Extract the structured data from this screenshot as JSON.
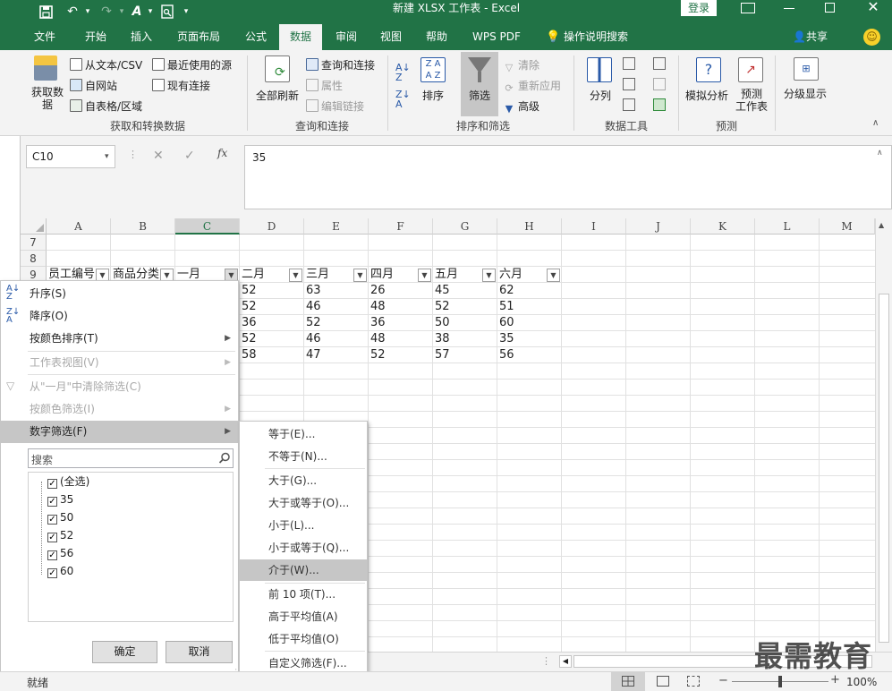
{
  "window": {
    "title": "新建 XLSX 工作表 - Excel",
    "login": "登录"
  },
  "tabs": [
    "文件",
    "开始",
    "插入",
    "页面布局",
    "公式",
    "数据",
    "审阅",
    "视图",
    "帮助",
    "WPS PDF"
  ],
  "active_tab": "数据",
  "tell_me": "操作说明搜索",
  "share": "共享",
  "ribbon": {
    "get_data": "获取数\n据",
    "from_text_csv": "从文本/CSV",
    "from_web": "自网站",
    "from_table": "自表格/区域",
    "recent_sources": "最近使用的源",
    "existing_connections": "现有连接",
    "group1_label": "获取和转换数据",
    "refresh_all": "全部刷新",
    "queries_connections": "查询和连接",
    "properties": "属性",
    "edit_links": "编辑链接",
    "group2_label": "查询和连接",
    "sort": "排序",
    "filter": "筛选",
    "clear": "清除",
    "reapply": "重新应用",
    "advanced": "高级",
    "group3_label": "排序和筛选",
    "text_to_columns": "分列",
    "group4_label": "数据工具",
    "what_if": "模拟分析",
    "forecast_sheet": "预测\n工作表",
    "group5_label": "预测",
    "outline": "分级显示"
  },
  "formula_bar": {
    "name_box": "C10",
    "value": "35",
    "fx": "fx"
  },
  "sheet": {
    "columns": [
      "A",
      "B",
      "C",
      "D",
      "E",
      "F",
      "G",
      "H",
      "I",
      "J",
      "K",
      "L",
      "M"
    ],
    "row_numbers": [
      "7",
      "8",
      "9"
    ],
    "headers": [
      "员工编号",
      "商品分类",
      "一月",
      "二月",
      "三月",
      "四月",
      "五月",
      "六月"
    ],
    "rows": [
      [
        "52",
        "63",
        "26",
        "45",
        "62"
      ],
      [
        "52",
        "46",
        "48",
        "52",
        "51"
      ],
      [
        "36",
        "52",
        "36",
        "50",
        "60"
      ],
      [
        "52",
        "46",
        "48",
        "38",
        "35"
      ],
      [
        "58",
        "47",
        "52",
        "57",
        "56"
      ]
    ]
  },
  "filter_menu": {
    "sort_asc": "升序(S)",
    "sort_desc": "降序(O)",
    "sort_by_color": "按颜色排序(T)",
    "sheet_view": "工作表视图(V)",
    "clear_filter": "从\"一月\"中清除筛选(C)",
    "filter_by_color": "按颜色筛选(I)",
    "number_filters": "数字筛选(F)",
    "search_placeholder": "搜索",
    "checkbox_items": [
      "(全选)",
      "35",
      "50",
      "52",
      "56",
      "60"
    ],
    "ok": "确定",
    "cancel": "取消"
  },
  "number_submenu": [
    "等于(E)...",
    "不等于(N)...",
    "大于(G)...",
    "大于或等于(O)...",
    "小于(L)...",
    "小于或等于(Q)...",
    "介于(W)...",
    "前 10 项(T)...",
    "高于平均值(A)",
    "低于平均值(O)",
    "自定义筛选(F)..."
  ],
  "status": {
    "ready": "就绪",
    "zoom": "100%"
  },
  "watermark": "最需教育"
}
